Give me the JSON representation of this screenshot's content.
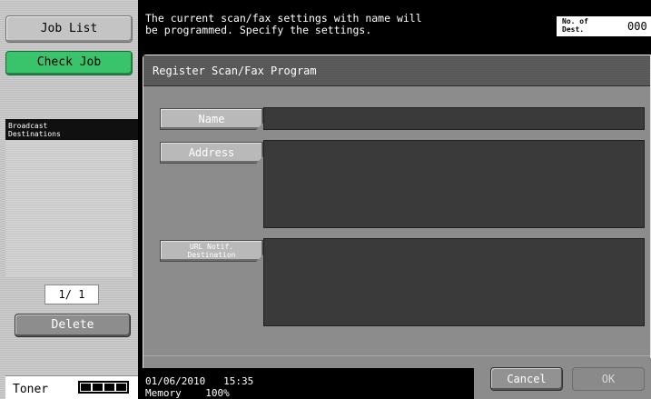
{
  "sidebar": {
    "job_list_label": "Job List",
    "check_job_label": "Check Job",
    "broadcast_header_line1": "Broadcast",
    "broadcast_header_line2": "Destinations",
    "page_indicator": "1/ 1",
    "delete_label": "Delete",
    "toner_label": "Toner",
    "toner_level": 1.0
  },
  "header": {
    "message_line1": "The current scan/fax settings with name will",
    "message_line2": "be programmed. Specify the settings.",
    "dest_label_line1": "No. of",
    "dest_label_line2": "Dest.",
    "dest_count": "000"
  },
  "main": {
    "title": "Register Scan/Fax Program",
    "name_label": "Name",
    "address_label": "Address",
    "url_label_line1": "URL Notif.",
    "url_label_line2": "Destination",
    "name_value": "",
    "address_value": "",
    "url_value": ""
  },
  "status": {
    "date": "01/06/2010",
    "time": "15:35",
    "memory_label": "Memory",
    "memory_value": "100%"
  },
  "footer": {
    "cancel_label": "Cancel",
    "ok_label": "OK"
  },
  "colors": {
    "check_job_green": "#39c36b",
    "panel_gray": "#8c8c8c",
    "field_dark": "#3a3a3a"
  }
}
